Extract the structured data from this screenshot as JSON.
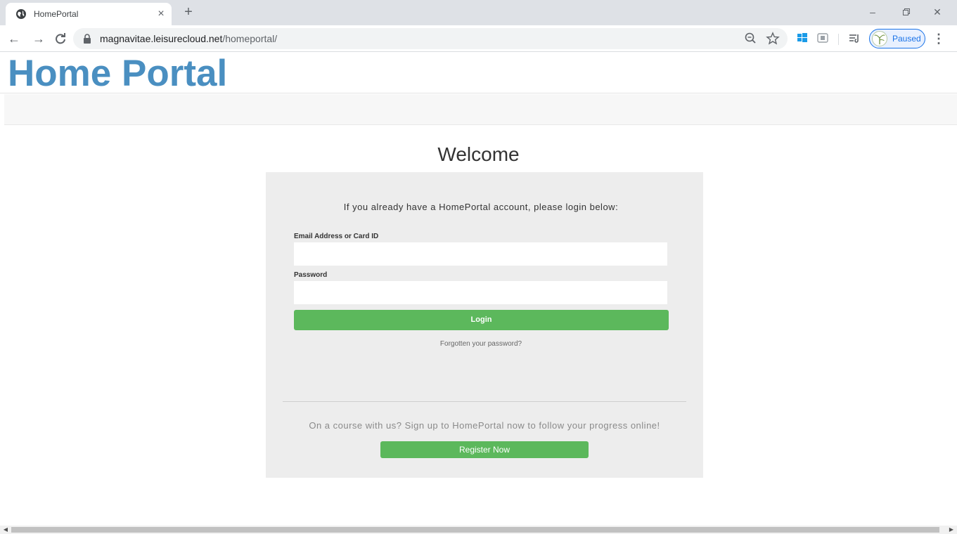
{
  "browser": {
    "tab_title": "HomePortal",
    "tab_close": "×",
    "new_tab": "+",
    "url_host": "magnavitae.leisurecloud.net",
    "url_path": "/homeportal/",
    "profile_status": "Paused",
    "icons": [
      "globe-icon",
      "back-icon",
      "forward-icon",
      "reload-icon",
      "lock-icon",
      "zoom-icon",
      "star-icon",
      "windows-icon",
      "reader-icon",
      "reading-list-icon",
      "profile-avatar",
      "menu-icon",
      "minimize-icon",
      "restore-icon",
      "close-window-icon"
    ]
  },
  "header": {
    "brand": "Home Portal",
    "brand_color": "#4a8fc1"
  },
  "main": {
    "welcome": "Welcome",
    "intro": "If you already have a HomePortal account, please login below:",
    "email_label": "Email Address or Card ID",
    "email_value": "",
    "password_label": "Password",
    "password_value": "",
    "login_button": "Login",
    "forgot_link": "Forgotten your password?",
    "signup_text": "On a course with us? Sign up to HomePortal now to follow your progress online!",
    "register_button": "Register Now",
    "button_color": "#5cb85c"
  }
}
